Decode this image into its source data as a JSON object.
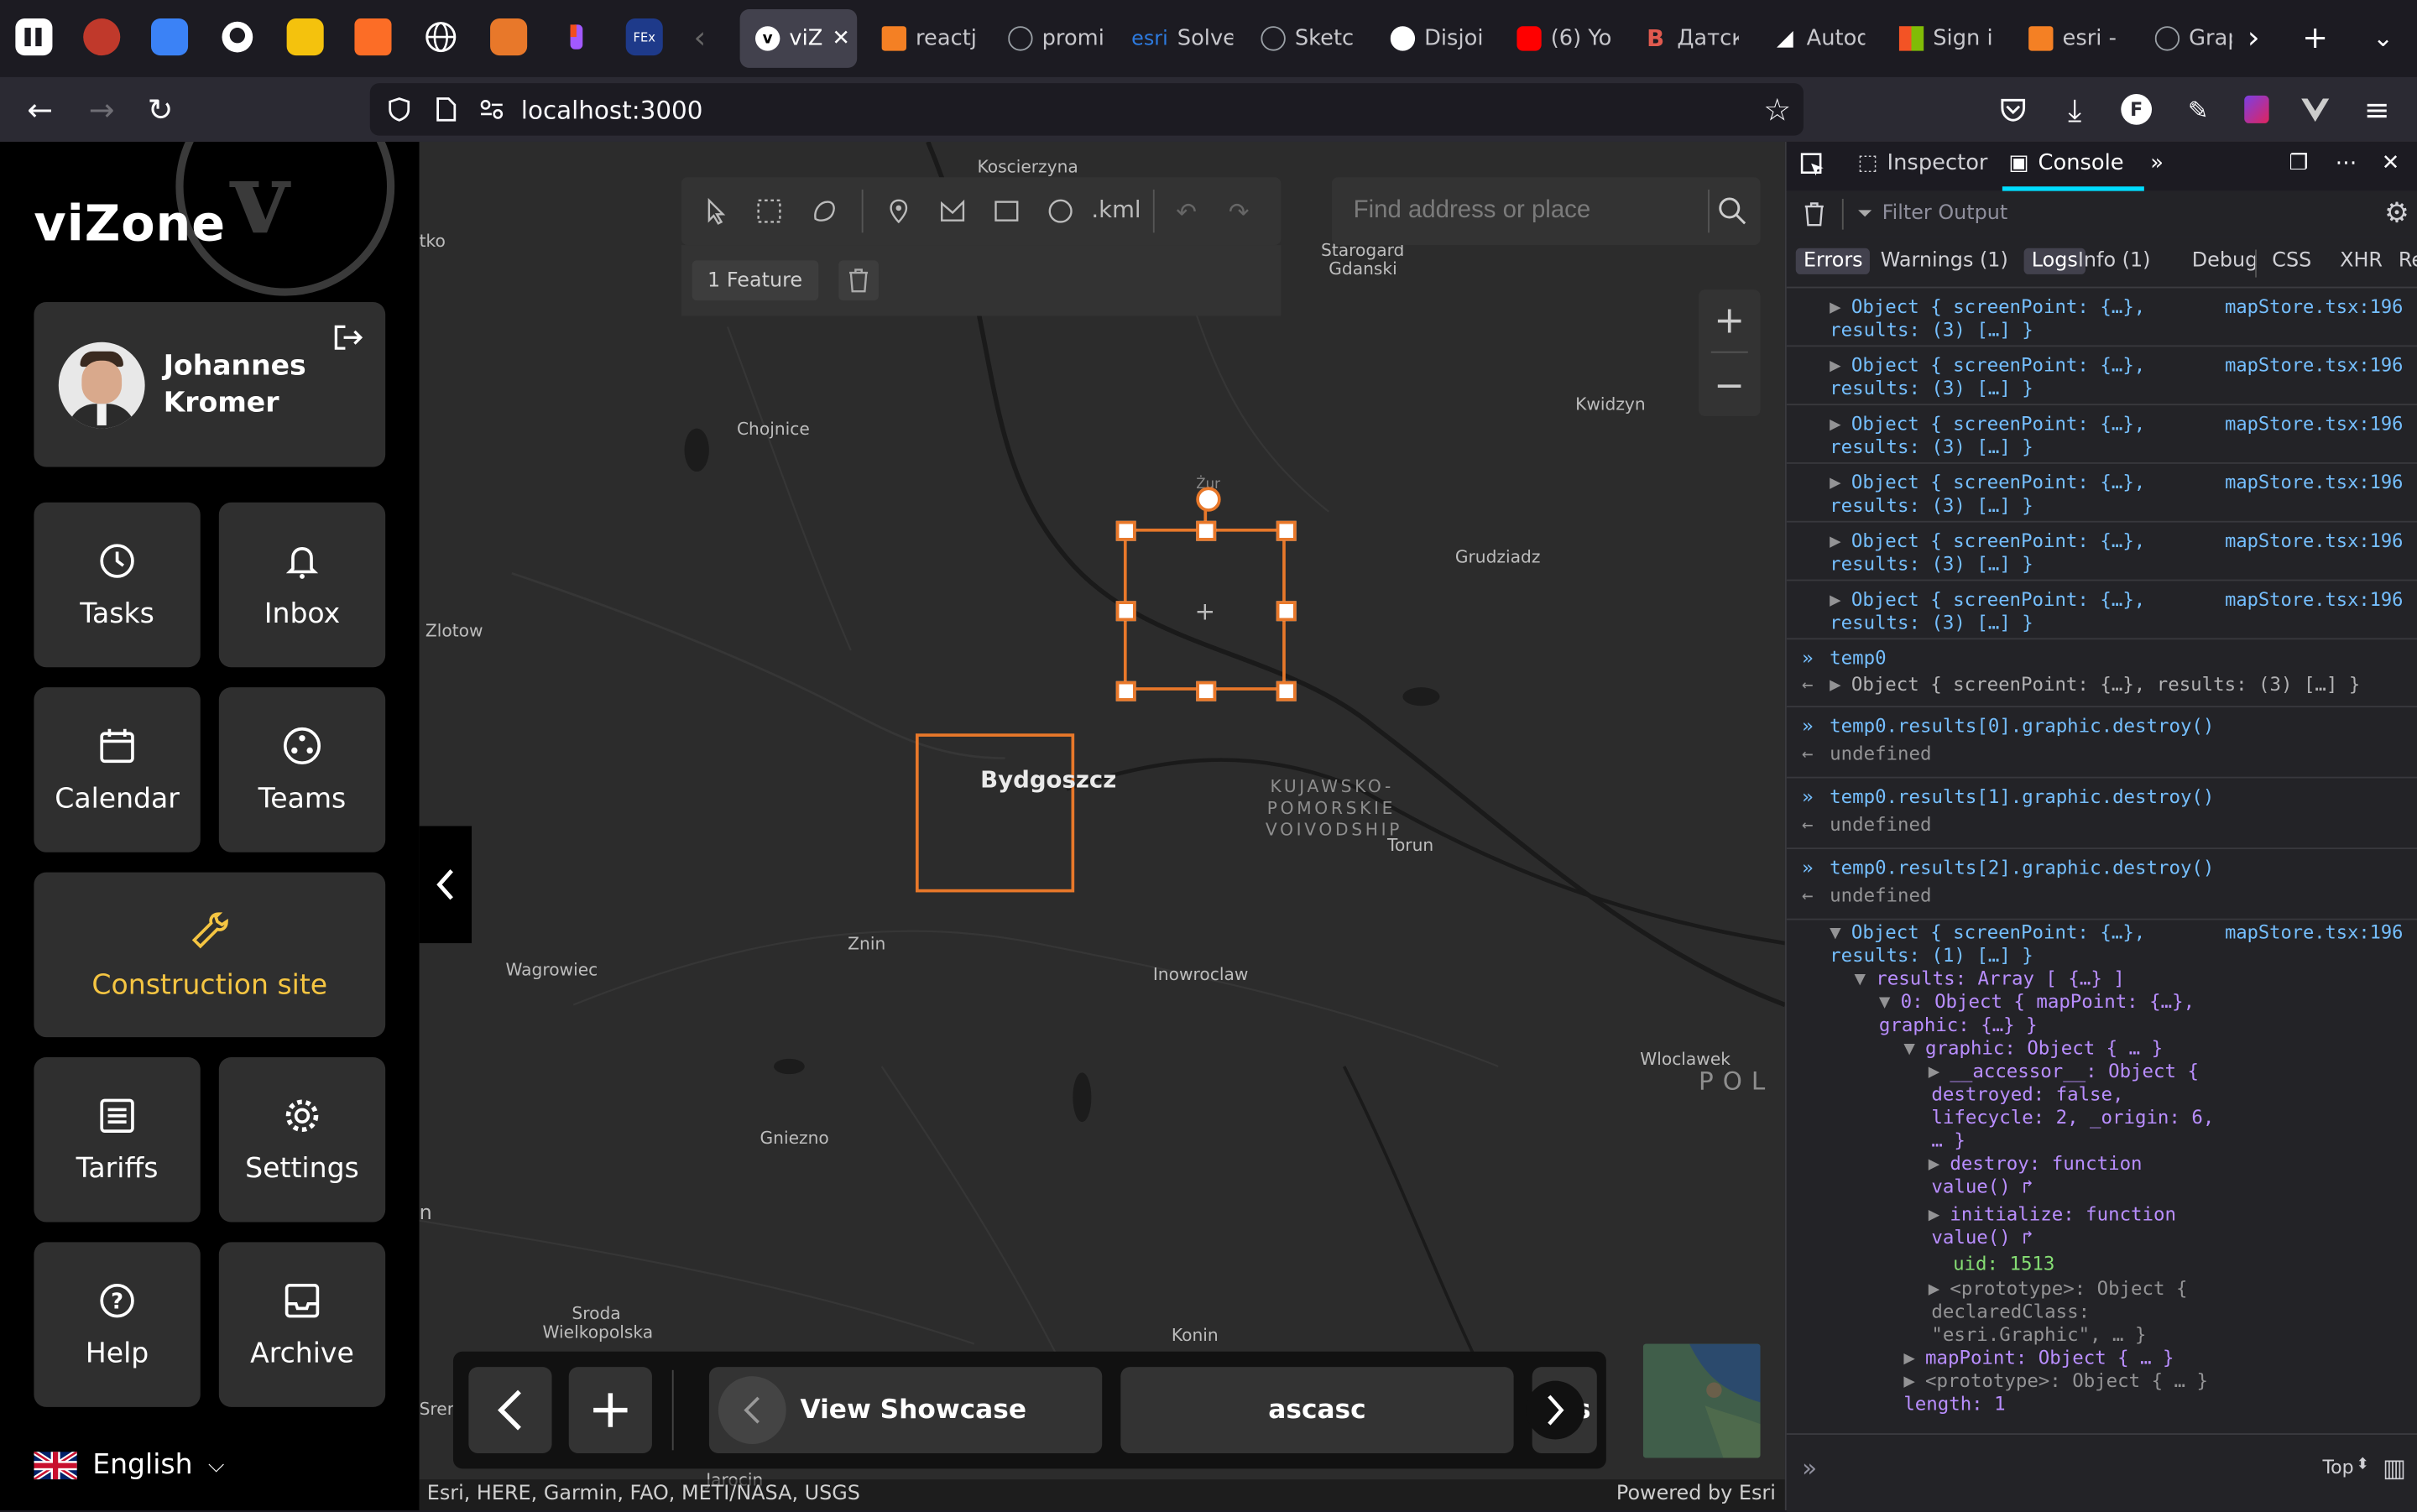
{
  "browser": {
    "url": "localhost:3000",
    "active_tab": "viZ",
    "tabs": [
      {
        "label": "reactj",
        "icon": "stackoverflow-icon",
        "color": "#f48024"
      },
      {
        "label": "promi",
        "icon": "globe-icon",
        "color": "#9aa0a6"
      },
      {
        "label": "Solve",
        "icon": "esri-icon",
        "color": "#2d7be0",
        "prefix": "esri"
      },
      {
        "label": "Sketc",
        "icon": "globe-icon",
        "color": "#9aa0a6"
      },
      {
        "label": "Disjoi",
        "icon": "github-icon",
        "color": "#ffffff"
      },
      {
        "label": "(6) Yo",
        "icon": "youtube-icon",
        "color": "#ff0000"
      },
      {
        "label": "Датск",
        "icon": "b-icon",
        "color": "#e05a4f"
      },
      {
        "label": "Autod",
        "icon": "autodesk-icon",
        "color": "#ffffff"
      },
      {
        "label": "Sign i",
        "icon": "microsoft-icon",
        "color": "#f35325"
      },
      {
        "label": "esri -",
        "icon": "stackoverflow-icon",
        "color": "#f48024"
      },
      {
        "label": "Grap",
        "icon": "globe-icon",
        "color": "#9aa0a6"
      }
    ]
  },
  "app": {
    "logo": "viZone",
    "user": {
      "first_name": "Johannes",
      "last_name": "Kromer"
    },
    "menu": [
      {
        "label": "Tasks",
        "icon": "clock-icon"
      },
      {
        "label": "Inbox",
        "icon": "bell-icon"
      },
      {
        "label": "Calendar",
        "icon": "calendar-icon"
      },
      {
        "label": "Teams",
        "icon": "teams-icon"
      },
      {
        "label": "Construction site",
        "icon": "wrench-icon",
        "color": "#f5c542"
      },
      {
        "label": "Tariffs",
        "icon": "list-icon"
      },
      {
        "label": "Settings",
        "icon": "gear-icon"
      },
      {
        "label": "Help",
        "icon": "help-icon"
      },
      {
        "label": "Archive",
        "icon": "archive-icon"
      }
    ],
    "language": "English"
  },
  "map": {
    "search_placeholder": "Find address or place",
    "feature_count": "1 Feature",
    "kml_label": ".kml",
    "labels": {
      "koscierzyna": "Koscierzyna",
      "starogard": "Starogard",
      "gdanski": "Gdanski",
      "chojnice": "Chojnice",
      "kwidzyn": "Kwidzyn",
      "zlotow": "Zlotow",
      "grudziadz": "Grudziadz",
      "bydgoszcz": "Bydgoszcz",
      "kujawsko": "KUJAWSKO-",
      "pomorskie": "POMORSKIE",
      "voivodship": "VOIVODSHIP",
      "torun": "Torun",
      "znin": "Znin",
      "wagrowiec": "Wagrowiec",
      "inowroclaw": "Inowroclaw",
      "wloclawek": "Wloclawek",
      "pol": "POL",
      "gniezno": "Gniezno",
      "sroda": "Sroda",
      "wielkopolska": "Wielkopolska",
      "konin": "Konin",
      "srem": "Srem",
      "jarocin": "Jarocin",
      "tko": "tko",
      "n": "n",
      "zur": "Żur"
    },
    "bottom_bar": {
      "view_showcase": "View Showcase",
      "ascasc": "ascasc",
      "partial": "s"
    },
    "attribution_left": "Esri, HERE, Garmin, FAO, METI/NASA, USGS",
    "attribution_right": "Powered by Esri",
    "accent_color": "#e8782a"
  },
  "devtools": {
    "tabs": {
      "inspector": "Inspector",
      "console": "Console"
    },
    "filter_placeholder": "Filter Output",
    "levels": [
      "Errors",
      "Warnings (1)",
      "Logs",
      "Info (1)",
      "Debug",
      "CSS",
      "XHR",
      "Req"
    ],
    "source": "mapStore.tsx:196",
    "object_line1": "Object { screenPoint: {…},",
    "object_line2": "results: (3) […] }",
    "input_temp0": "temp0",
    "result_temp0": "Object { screenPoint: {…}, results: (3) […] }",
    "cmd0": "temp0.results[0].graphic.destroy()",
    "cmd1": "temp0.results[1].graphic.destroy()",
    "cmd2": "temp0.results[2].graphic.destroy()",
    "undefined": "undefined",
    "expanded": [
      "Object { screenPoint: {…},",
      "results: (1) […] }",
      "results: Array [ {…} ]",
      "0: Object { mapPoint: {…},",
      "graphic: {…} }",
      "graphic: Object { … }",
      "__accessor__: Object {",
      "destroyed: false,",
      "lifecycle: 2, _origin: 6,",
      "… }",
      "destroy: function",
      "value() ↱",
      "initialize: function",
      "value() ↱",
      "uid: 1513",
      "<prototype>: Object {",
      "declaredClass:",
      "\"esri.Graphic\", … }",
      "mapPoint: Object { … }",
      "<prototype>: Object { … }",
      "length: 1"
    ],
    "top_label": "Top"
  }
}
